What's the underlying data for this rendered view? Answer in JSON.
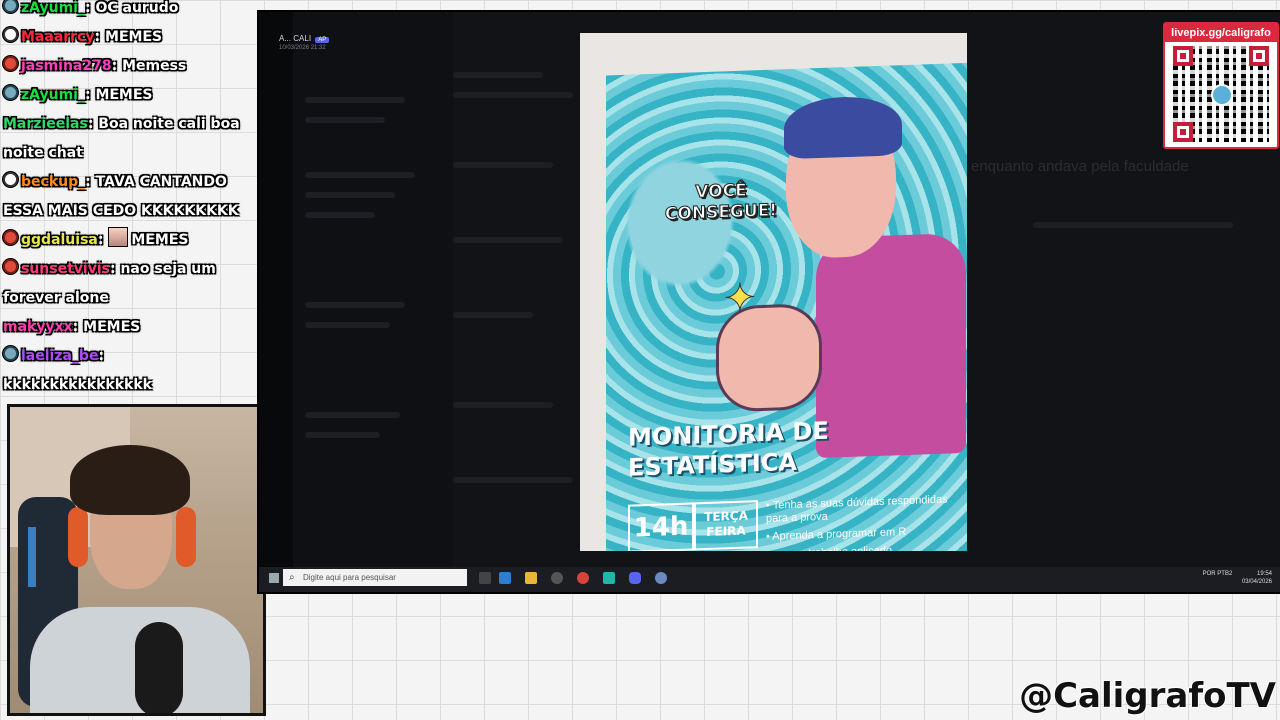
{
  "chat": [
    {
      "user": "zAyumi_",
      "user_color": "#18e03b",
      "msg": ": OC aurudo",
      "badge": "b3"
    },
    {
      "user": "Maaarrcy",
      "user_color": "#ff2a3a",
      "msg": ": MEMES",
      "badge": "b1"
    },
    {
      "user": "jasmina278",
      "user_color": "#ff3fc0",
      "msg": ": Memess",
      "badge": "b2"
    },
    {
      "user": "zAyumi_",
      "user_color": "#18e03b",
      "msg": ": MEMES",
      "badge": "b3"
    },
    {
      "user": "Marzieelas",
      "user_color": "#30d868",
      "msg": ": Boa noite cali boa noite chat",
      "badge": ""
    },
    {
      "user": "beckup_",
      "user_color": "#ff8a1e",
      "msg": ": TAVA CANTANDO ESSA MAIS CEDO KKKKKKKKK",
      "badge": "b1"
    },
    {
      "user": "ggdaluisa",
      "user_color": "#e8e84a",
      "msg": ": ",
      "emote": true,
      "msg2": "MEMES",
      "badge": "b2"
    },
    {
      "user": "sunsetvivis",
      "user_color": "#ff3a7a",
      "msg": ": nao seja um forever alone",
      "badge": "b2"
    },
    {
      "user": "makyyxx",
      "user_color": "#ff3fb0",
      "msg": ": MEMES",
      "badge": ""
    },
    {
      "user": "laeliza_be",
      "user_color": "#b04aff",
      "msg": ": kkkkkkkkkkkkkkkk",
      "badge": "b3"
    }
  ],
  "discord": {
    "header_user": "A...",
    "header_tag": "CALI",
    "header_badge": "AP",
    "header_timestamp": "10/03/2026 21:32",
    "ghost_title": "enquanto andava pela faculdade"
  },
  "poster": {
    "bubble_text": "VOCÊ CONSEGUE!",
    "title_line1": "MONITORIA DE",
    "title_line2": "ESTATÍSTICA",
    "hour": "14h",
    "day": "TERÇA FEIRA",
    "bullet1": "• Tenha as suas dúvidas respondidas para a prova",
    "bullet2": "• Aprenda a programar em R",
    "bullet3": "... o seu trabalho aplicado"
  },
  "taskbar": {
    "search_placeholder": "Digite aqui para pesquisar",
    "lang": "POR PTB2",
    "time": "19:54",
    "date": "03/04/2026"
  },
  "donate": {
    "url": "livepix.gg/caligrafo"
  },
  "handle": "@CaligrafoTV"
}
